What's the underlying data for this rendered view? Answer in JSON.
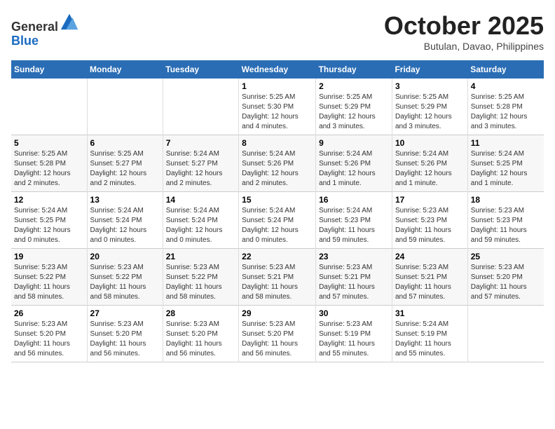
{
  "header": {
    "logo_line1": "General",
    "logo_line2": "Blue",
    "month_title": "October 2025",
    "subtitle": "Butulan, Davao, Philippines"
  },
  "days_of_week": [
    "Sunday",
    "Monday",
    "Tuesday",
    "Wednesday",
    "Thursday",
    "Friday",
    "Saturday"
  ],
  "weeks": [
    [
      {
        "day": "",
        "info": ""
      },
      {
        "day": "",
        "info": ""
      },
      {
        "day": "",
        "info": ""
      },
      {
        "day": "1",
        "info": "Sunrise: 5:25 AM\nSunset: 5:30 PM\nDaylight: 12 hours\nand 4 minutes."
      },
      {
        "day": "2",
        "info": "Sunrise: 5:25 AM\nSunset: 5:29 PM\nDaylight: 12 hours\nand 3 minutes."
      },
      {
        "day": "3",
        "info": "Sunrise: 5:25 AM\nSunset: 5:29 PM\nDaylight: 12 hours\nand 3 minutes."
      },
      {
        "day": "4",
        "info": "Sunrise: 5:25 AM\nSunset: 5:28 PM\nDaylight: 12 hours\nand 3 minutes."
      }
    ],
    [
      {
        "day": "5",
        "info": "Sunrise: 5:25 AM\nSunset: 5:28 PM\nDaylight: 12 hours\nand 2 minutes."
      },
      {
        "day": "6",
        "info": "Sunrise: 5:25 AM\nSunset: 5:27 PM\nDaylight: 12 hours\nand 2 minutes."
      },
      {
        "day": "7",
        "info": "Sunrise: 5:24 AM\nSunset: 5:27 PM\nDaylight: 12 hours\nand 2 minutes."
      },
      {
        "day": "8",
        "info": "Sunrise: 5:24 AM\nSunset: 5:26 PM\nDaylight: 12 hours\nand 2 minutes."
      },
      {
        "day": "9",
        "info": "Sunrise: 5:24 AM\nSunset: 5:26 PM\nDaylight: 12 hours\nand 1 minute."
      },
      {
        "day": "10",
        "info": "Sunrise: 5:24 AM\nSunset: 5:26 PM\nDaylight: 12 hours\nand 1 minute."
      },
      {
        "day": "11",
        "info": "Sunrise: 5:24 AM\nSunset: 5:25 PM\nDaylight: 12 hours\nand 1 minute."
      }
    ],
    [
      {
        "day": "12",
        "info": "Sunrise: 5:24 AM\nSunset: 5:25 PM\nDaylight: 12 hours\nand 0 minutes."
      },
      {
        "day": "13",
        "info": "Sunrise: 5:24 AM\nSunset: 5:24 PM\nDaylight: 12 hours\nand 0 minutes."
      },
      {
        "day": "14",
        "info": "Sunrise: 5:24 AM\nSunset: 5:24 PM\nDaylight: 12 hours\nand 0 minutes."
      },
      {
        "day": "15",
        "info": "Sunrise: 5:24 AM\nSunset: 5:24 PM\nDaylight: 12 hours\nand 0 minutes."
      },
      {
        "day": "16",
        "info": "Sunrise: 5:24 AM\nSunset: 5:23 PM\nDaylight: 11 hours\nand 59 minutes."
      },
      {
        "day": "17",
        "info": "Sunrise: 5:23 AM\nSunset: 5:23 PM\nDaylight: 11 hours\nand 59 minutes."
      },
      {
        "day": "18",
        "info": "Sunrise: 5:23 AM\nSunset: 5:23 PM\nDaylight: 11 hours\nand 59 minutes."
      }
    ],
    [
      {
        "day": "19",
        "info": "Sunrise: 5:23 AM\nSunset: 5:22 PM\nDaylight: 11 hours\nand 58 minutes."
      },
      {
        "day": "20",
        "info": "Sunrise: 5:23 AM\nSunset: 5:22 PM\nDaylight: 11 hours\nand 58 minutes."
      },
      {
        "day": "21",
        "info": "Sunrise: 5:23 AM\nSunset: 5:22 PM\nDaylight: 11 hours\nand 58 minutes."
      },
      {
        "day": "22",
        "info": "Sunrise: 5:23 AM\nSunset: 5:21 PM\nDaylight: 11 hours\nand 58 minutes."
      },
      {
        "day": "23",
        "info": "Sunrise: 5:23 AM\nSunset: 5:21 PM\nDaylight: 11 hours\nand 57 minutes."
      },
      {
        "day": "24",
        "info": "Sunrise: 5:23 AM\nSunset: 5:21 PM\nDaylight: 11 hours\nand 57 minutes."
      },
      {
        "day": "25",
        "info": "Sunrise: 5:23 AM\nSunset: 5:20 PM\nDaylight: 11 hours\nand 57 minutes."
      }
    ],
    [
      {
        "day": "26",
        "info": "Sunrise: 5:23 AM\nSunset: 5:20 PM\nDaylight: 11 hours\nand 56 minutes."
      },
      {
        "day": "27",
        "info": "Sunrise: 5:23 AM\nSunset: 5:20 PM\nDaylight: 11 hours\nand 56 minutes."
      },
      {
        "day": "28",
        "info": "Sunrise: 5:23 AM\nSunset: 5:20 PM\nDaylight: 11 hours\nand 56 minutes."
      },
      {
        "day": "29",
        "info": "Sunrise: 5:23 AM\nSunset: 5:20 PM\nDaylight: 11 hours\nand 56 minutes."
      },
      {
        "day": "30",
        "info": "Sunrise: 5:23 AM\nSunset: 5:19 PM\nDaylight: 11 hours\nand 55 minutes."
      },
      {
        "day": "31",
        "info": "Sunrise: 5:24 AM\nSunset: 5:19 PM\nDaylight: 11 hours\nand 55 minutes."
      },
      {
        "day": "",
        "info": ""
      }
    ]
  ]
}
